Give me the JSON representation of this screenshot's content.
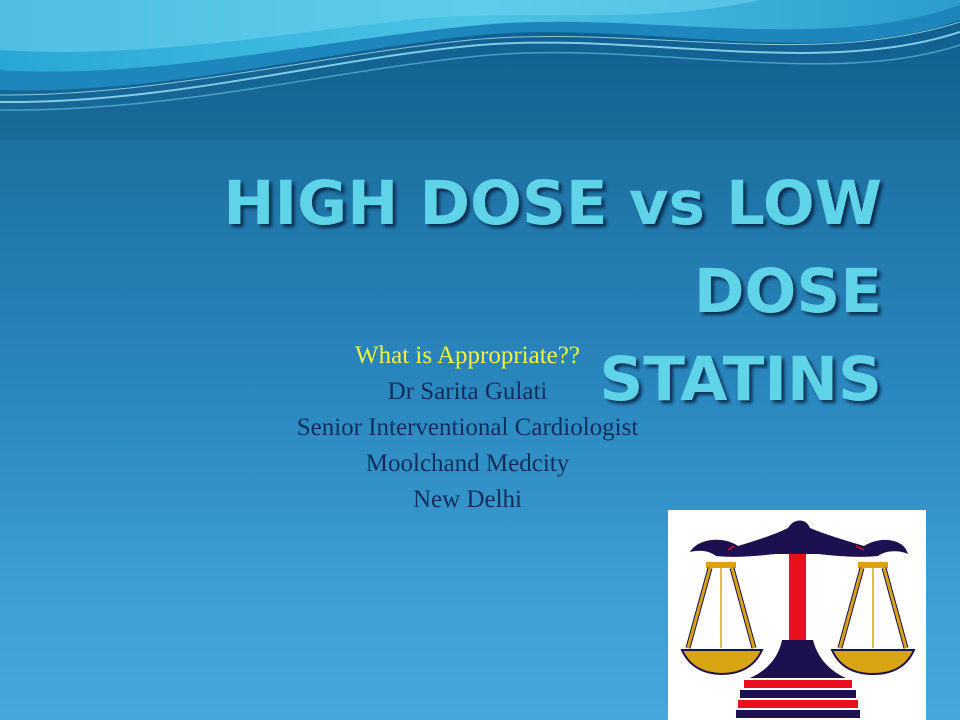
{
  "slide": {
    "title_line1": "HIGH DOSE vs LOW DOSE",
    "title_line2": "STATINS",
    "subtitle": {
      "tagline": "What is Appropriate??",
      "presenter": "Dr Sarita Gulati",
      "role": "Senior Interventional Cardiologist",
      "institution": "Moolchand Medcity",
      "city": "New Delhi"
    },
    "logo_icon": "balance-scale-icon",
    "colors": {
      "title": "#5fd3e8",
      "subtitle": "#0f2d5c",
      "highlight": "#f4f23c",
      "background_top": "#1a6a9a",
      "background_bottom": "#46a8da",
      "scale_beam": "#1c1050",
      "scale_pillar": "#e8101c",
      "scale_pans": "#d9a411"
    }
  }
}
